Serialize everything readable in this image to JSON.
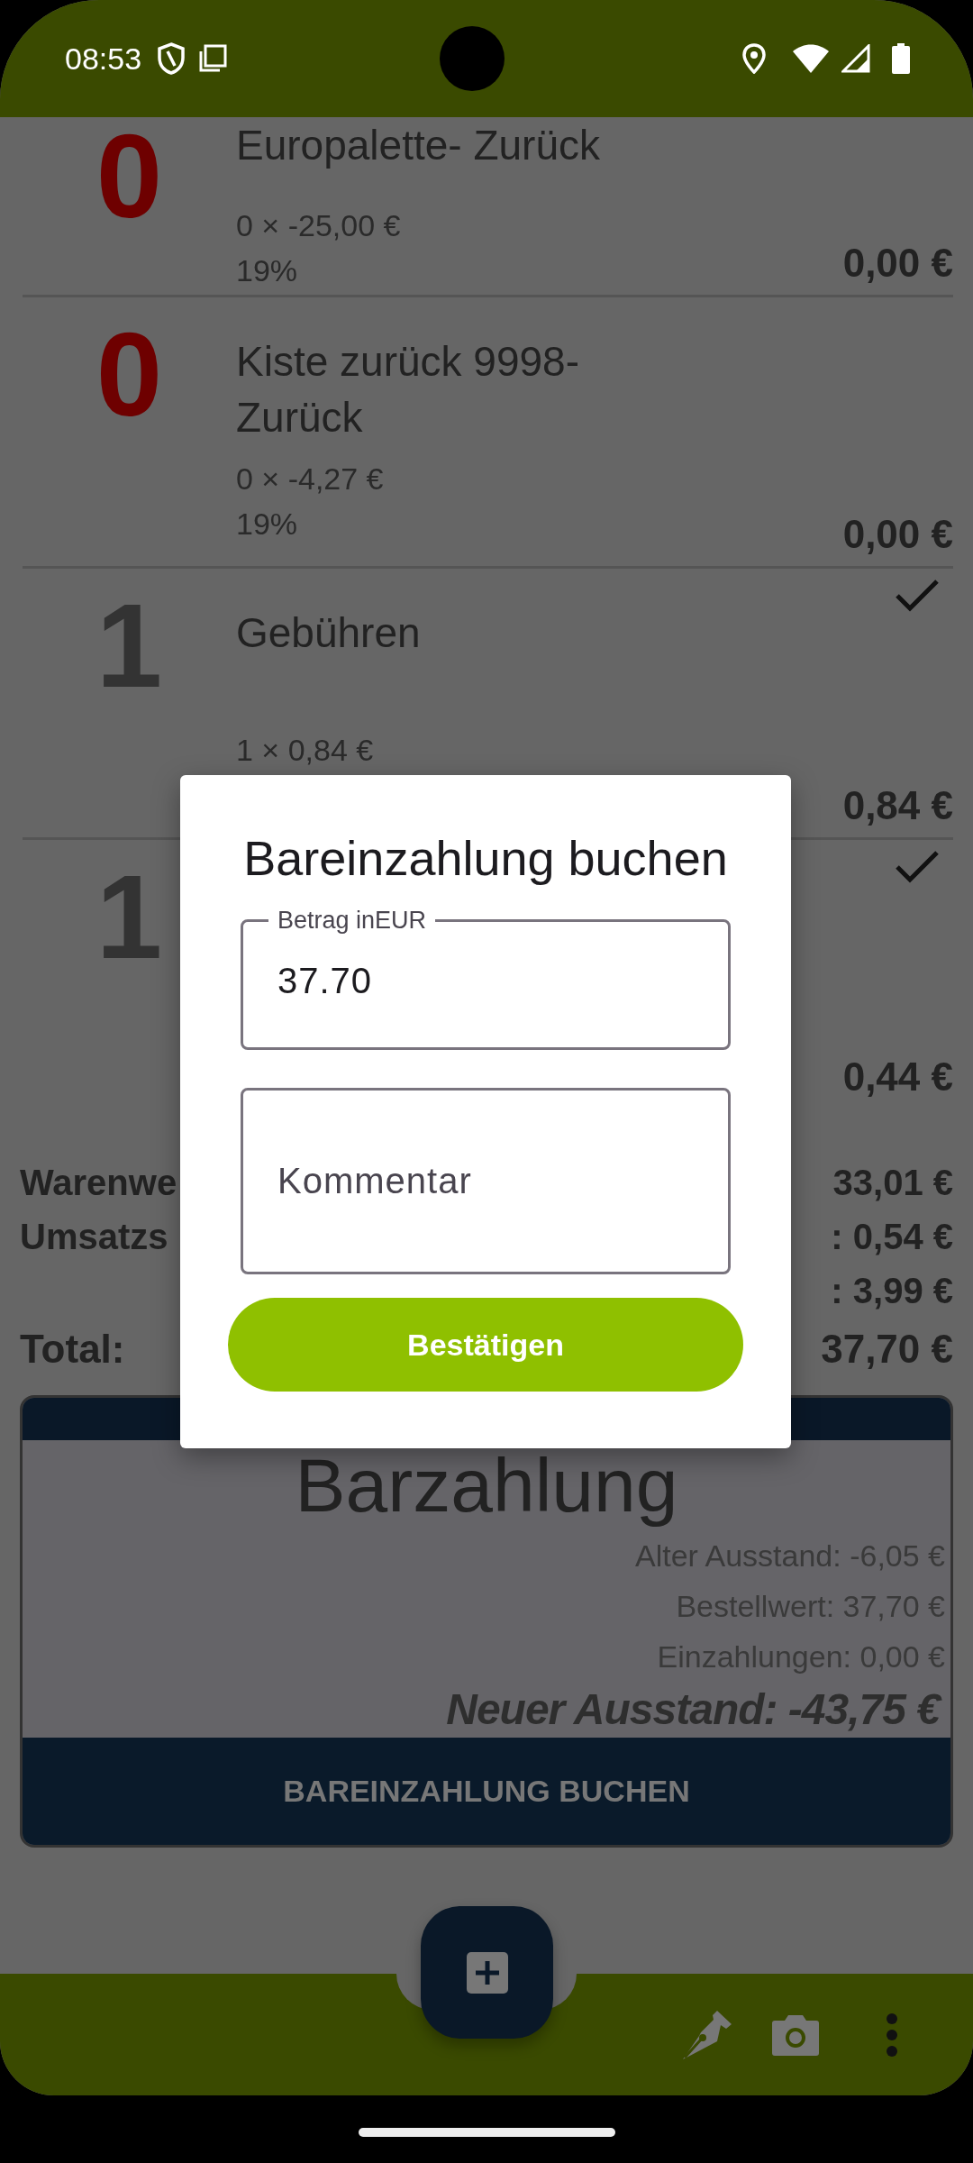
{
  "status_bar": {
    "time": "08:53"
  },
  "items": [
    {
      "quantity": "0",
      "color": "#6e0000",
      "checked": false,
      "name": "Europalette- Zurück",
      "unit_line": "0 × -25,00 €",
      "tax": "19%",
      "total": "0,00 €"
    },
    {
      "quantity": "0",
      "color": "#6e0000",
      "checked": false,
      "name": "Kiste zurück 9998-Zurück",
      "unit_line": "0 × -4,27 €",
      "tax": "19%",
      "total": "0,00 €"
    },
    {
      "quantity": "1",
      "color": "#333333",
      "checked": true,
      "name": "Gebühren",
      "unit_line": "1 × 0,84 €",
      "total": "0,84 €"
    },
    {
      "quantity": "1",
      "color": "#333333",
      "checked": true,
      "total": "0,44 €"
    }
  ],
  "summary": [
    {
      "label": "Warenwe",
      "value": "33,01 €"
    },
    {
      "label": "Umsatzs",
      "value": ": 0,54 €"
    },
    {
      "value": ": 3,99 €"
    }
  ],
  "total": {
    "label": "Total:",
    "value": "37,70 €"
  },
  "payment_card": {
    "title": "Barzahlung",
    "lines": [
      "Alter Ausstand: -6,05 €",
      "Bestellwert: 37,70 €",
      "Einzahlungen: 0,00 €"
    ],
    "balance": "Neuer Ausstand: -43,75 €",
    "button": "BAREINZAHLUNG BUCHEN"
  },
  "dialog": {
    "title": "Bareinzahlung buchen",
    "amount_field": {
      "label": "Betrag inEUR",
      "value": "37.70"
    },
    "comment_field": {
      "placeholder": "Kommentar"
    },
    "confirm_button": "Bestätigen"
  }
}
